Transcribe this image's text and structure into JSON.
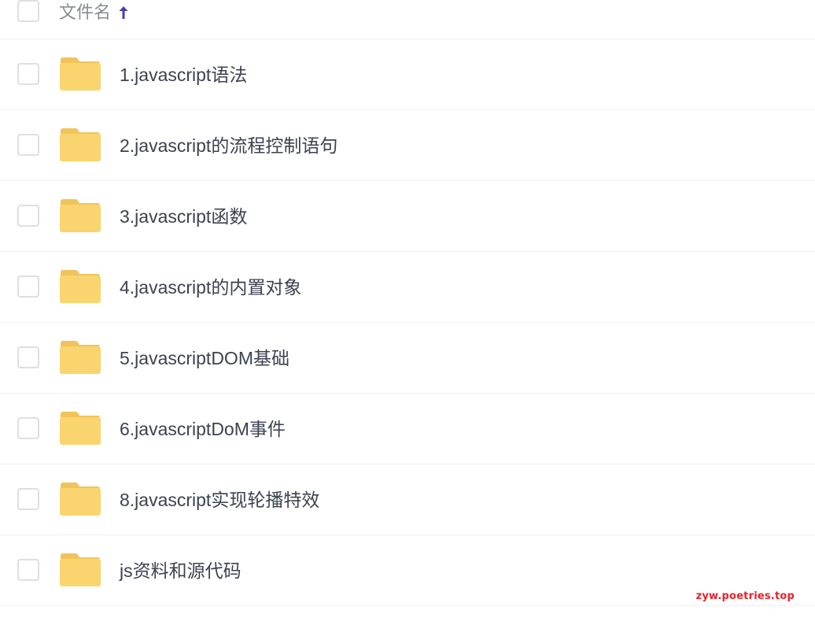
{
  "header": {
    "title": "文件名",
    "sort_icon": "arrow-up-icon",
    "sort_color": "#4a3fa6"
  },
  "colors": {
    "folder_body": "#fad46e",
    "folder_tab": "#f0c45a",
    "text": "#3d4250",
    "header_text": "#888c95",
    "divider": "#f0f1f4",
    "watermark": "#e8202a"
  },
  "files": [
    {
      "name": "1.javascript语法",
      "icon": "folder-icon"
    },
    {
      "name": "2.javascript的流程控制语句",
      "icon": "folder-icon"
    },
    {
      "name": "3.javascript函数",
      "icon": "folder-icon"
    },
    {
      "name": "4.javascript的内置对象",
      "icon": "folder-icon"
    },
    {
      "name": "5.javascriptDOM基础",
      "icon": "folder-icon"
    },
    {
      "name": "6.javascriptDoM事件",
      "icon": "folder-icon"
    },
    {
      "name": "8.javascript实现轮播特效",
      "icon": "folder-icon"
    },
    {
      "name": "js资料和源代码",
      "icon": "folder-icon"
    }
  ],
  "watermark": "zyw.poetries.top"
}
